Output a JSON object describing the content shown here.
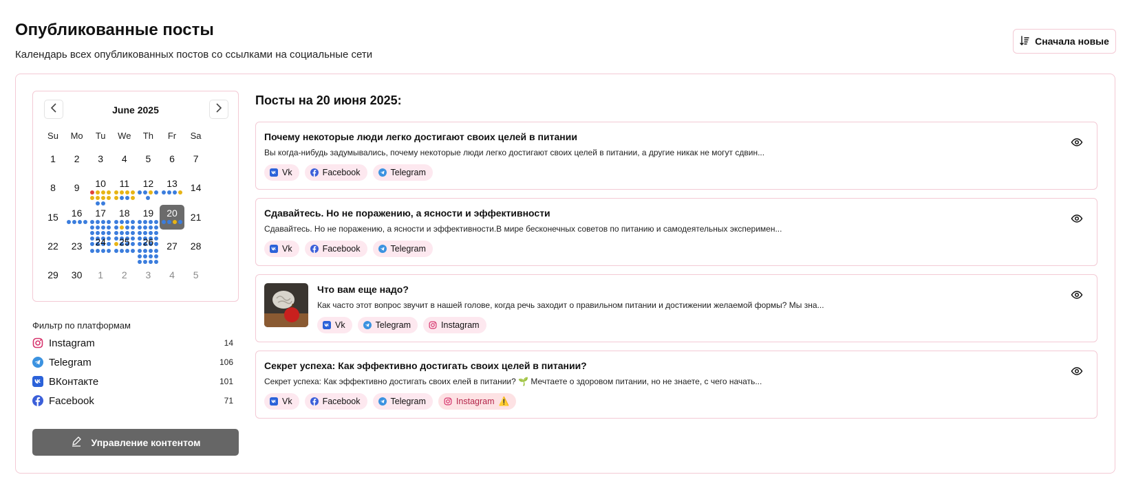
{
  "header": {
    "title": "Опубликованные посты",
    "subtitle": "Календарь всех опубликованных постов со ссылками на социальные сети",
    "sort_label": "Сначала новые"
  },
  "colors": {
    "accent_border": "#f3c9d4",
    "tag_bg": "#fde8ef",
    "dot_blue": "#3b7ddd",
    "dot_yellow": "#e7b416",
    "dot_red": "#e0413a",
    "selected_day": "#6b6b6b",
    "instagram": "#d6336c",
    "telegram": "#3b92e0",
    "vk": "#2b62d9",
    "facebook": "#3b5fd9"
  },
  "calendar": {
    "month_label": "June 2025",
    "weekdays": [
      "Su",
      "Mo",
      "Tu",
      "We",
      "Th",
      "Fr",
      "Sa"
    ],
    "weeks": [
      [
        {
          "d": "1"
        },
        {
          "d": "2"
        },
        {
          "d": "3"
        },
        {
          "d": "4"
        },
        {
          "d": "5"
        },
        {
          "d": "6"
        },
        {
          "d": "7"
        }
      ],
      [
        {
          "d": "8"
        },
        {
          "d": "9"
        },
        {
          "d": "10",
          "dots": [
            "red",
            "yellow",
            "yellow",
            "yellow",
            "yellow",
            "yellow",
            "yellow",
            "yellow",
            "blue",
            "blue"
          ]
        },
        {
          "d": "11",
          "dots": [
            "yellow",
            "yellow",
            "yellow",
            "yellow",
            "yellow",
            "blue",
            "blue",
            "yellow"
          ]
        },
        {
          "d": "12",
          "dots": [
            "blue",
            "blue",
            "yellow",
            "blue",
            "blue"
          ]
        },
        {
          "d": "13",
          "dots": [
            "blue",
            "blue",
            "blue",
            "yellow"
          ]
        },
        {
          "d": "14"
        }
      ],
      [
        {
          "d": "15"
        },
        {
          "d": "16",
          "dots": [
            "blue",
            "blue",
            "blue",
            "blue"
          ]
        },
        {
          "d": "17",
          "dots": [
            "blue",
            "blue",
            "blue",
            "blue",
            "blue",
            "blue",
            "blue",
            "blue",
            "blue",
            "blue",
            "blue",
            "blue",
            "blue",
            "blue",
            "blue",
            "blue",
            "blue",
            "blue",
            "blue",
            "blue"
          ]
        },
        {
          "d": "18",
          "dots": [
            "blue",
            "blue",
            "blue",
            "blue",
            "blue",
            "yellow",
            "blue",
            "blue",
            "blue",
            "blue",
            "blue",
            "blue",
            "blue",
            "blue",
            "blue",
            "blue",
            "yellow",
            "blue",
            "blue",
            "blue"
          ]
        },
        {
          "d": "19",
          "dots": [
            "blue",
            "blue",
            "blue",
            "blue",
            "blue",
            "blue",
            "blue",
            "blue",
            "blue",
            "blue",
            "blue",
            "blue",
            "blue",
            "blue",
            "blue",
            "blue",
            "blue",
            "blue",
            "blue",
            "blue"
          ]
        },
        {
          "d": "20",
          "selected": true,
          "dots": [
            "blue",
            "blue",
            "yellow",
            "blue"
          ]
        },
        {
          "d": "21"
        }
      ],
      [
        {
          "d": "22"
        },
        {
          "d": "23"
        },
        {
          "d": "24",
          "dots": [
            "blue",
            "blue",
            "blue",
            "blue"
          ]
        },
        {
          "d": "25",
          "dots": [
            "blue",
            "blue",
            "blue",
            "blue"
          ]
        },
        {
          "d": "26",
          "dots": [
            "blue",
            "blue",
            "blue",
            "blue",
            "blue",
            "blue",
            "blue",
            "blue",
            "blue",
            "blue",
            "blue",
            "blue"
          ]
        },
        {
          "d": "27"
        },
        {
          "d": "28"
        }
      ],
      [
        {
          "d": "29"
        },
        {
          "d": "30"
        },
        {
          "d": "1",
          "out": true
        },
        {
          "d": "2",
          "out": true
        },
        {
          "d": "3",
          "out": true
        },
        {
          "d": "4",
          "out": true
        },
        {
          "d": "5",
          "out": true
        }
      ]
    ]
  },
  "filters": {
    "title": "Фильтр по платформам",
    "items": [
      {
        "icon": "instagram-icon",
        "label": "Instagram",
        "count": "14"
      },
      {
        "icon": "telegram-icon",
        "label": "Telegram",
        "count": "106"
      },
      {
        "icon": "vk-icon",
        "label": "ВКонтакте",
        "count": "101"
      },
      {
        "icon": "facebook-icon",
        "label": "Facebook",
        "count": "71"
      }
    ]
  },
  "manage_button": {
    "label": "Управление контентом",
    "icon": "pencil-icon"
  },
  "posts": {
    "heading": "Посты на 20 июня 2025:",
    "items": [
      {
        "title": "Почему некоторые люди легко достигают своих целей в питании",
        "excerpt": "Вы когда-нибудь задумывались, почему некоторые люди легко достигают своих целей в питании, а другие никак не могут сдвин...",
        "has_image": false,
        "tags": [
          {
            "icon": "vk-icon",
            "label": "Vk"
          },
          {
            "icon": "facebook-icon",
            "label": "Facebook"
          },
          {
            "icon": "telegram-icon",
            "label": "Telegram"
          }
        ]
      },
      {
        "title": "Сдавайтесь. Но не поражению, а ясности и эффективности",
        "excerpt": "Сдавайтесь. Но не поражению, а ясности и эффективности.В мире бесконечных советов по питанию и самодеятельных эксперимен...",
        "has_image": false,
        "tags": [
          {
            "icon": "vk-icon",
            "label": "Vk"
          },
          {
            "icon": "facebook-icon",
            "label": "Facebook"
          },
          {
            "icon": "telegram-icon",
            "label": "Telegram"
          }
        ]
      },
      {
        "title": "Что вам еще надо?",
        "excerpt": "Как часто этот вопрос звучит в нашей голове, когда речь заходит о правильном питании и достижении желаемой формы? Мы зна...",
        "has_image": true,
        "tags": [
          {
            "icon": "vk-icon",
            "label": "Vk"
          },
          {
            "icon": "telegram-icon",
            "label": "Telegram"
          },
          {
            "icon": "instagram-icon",
            "label": "Instagram"
          }
        ]
      },
      {
        "title": "Секрет успеха: Как эффективно достигать своих целей в питании?",
        "excerpt": "Секрет успеха: Как эффективно достигать своих елей в питании? 🌱 Мечтаете о здоровом питании, но не знаете, с чего начать...",
        "has_image": false,
        "tags": [
          {
            "icon": "vk-icon",
            "label": "Vk"
          },
          {
            "icon": "facebook-icon",
            "label": "Facebook"
          },
          {
            "icon": "telegram-icon",
            "label": "Telegram"
          },
          {
            "icon": "instagram-icon",
            "label": "Instagram",
            "warning": "⚠️"
          }
        ]
      }
    ]
  }
}
